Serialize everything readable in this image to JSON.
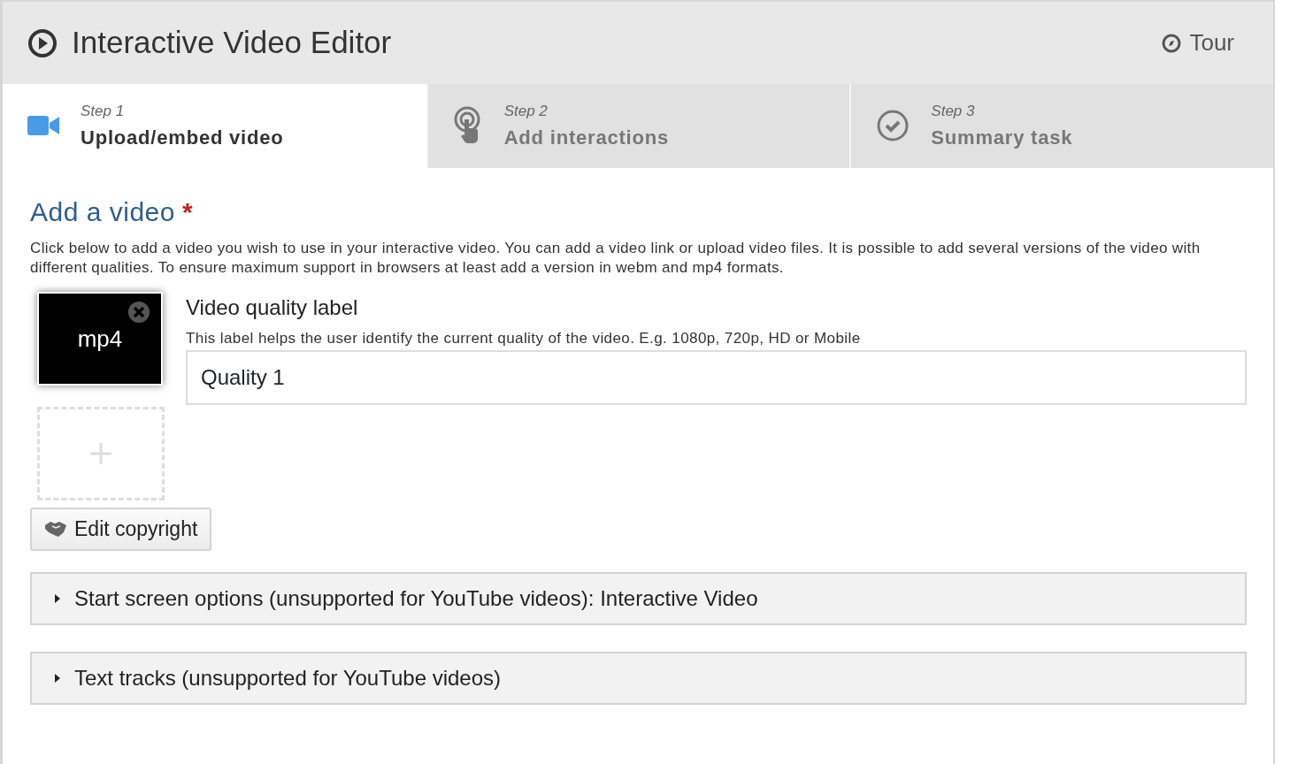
{
  "header": {
    "title": "Interactive Video Editor",
    "tour": "Tour"
  },
  "steps": [
    {
      "step": "Step 1",
      "label": "Upload/embed video",
      "selected": true,
      "kind": "camera"
    },
    {
      "step": "Step 2",
      "label": "Add interactions",
      "selected": false,
      "kind": "touch"
    },
    {
      "step": "Step 3",
      "label": "Summary task",
      "selected": false,
      "kind": "check"
    }
  ],
  "section": {
    "title": "Add a video",
    "required_mark": "*",
    "description": "Click below to add a video you wish to use in your interactive video. You can add a video link or upload video files. It is possible to add several versions of the video with different qualities. To ensure maximum support in browsers at least add a version in webm and mp4 formats."
  },
  "files": [
    {
      "label": "mp4"
    }
  ],
  "quality": {
    "label": "Video quality label",
    "help": "This label helps the user identify the current quality of the video. E.g. 1080p, 720p, HD or Mobile",
    "value": "Quality 1"
  },
  "copyright_button": "Edit copyright",
  "groups": [
    {
      "label": "Start screen options (unsupported for YouTube videos): Interactive Video",
      "expanded": false
    },
    {
      "label": "Text tracks (unsupported for YouTube videos)",
      "expanded": false
    }
  ]
}
